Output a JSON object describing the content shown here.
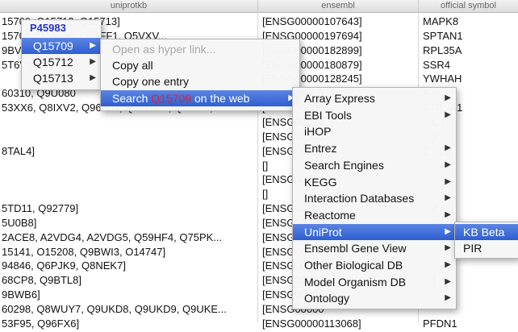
{
  "table": {
    "columns": [
      "uniprotkb",
      "ensembl",
      "official symbol"
    ],
    "rows": [
      [
        "15709, Q15712, Q15713]",
        "[ENSG00000107643]",
        "MAPK8"
      ],
      [
        "15709, Q16606, Q59FF1, Q5VXV...",
        "[ENSG00000197694]",
        "SPTAN1"
      ],
      [
        "9BVQ5",
        "[ENSG00000182899]",
        "RPL35A"
      ],
      [
        "5T6V9",
        "[ENSG00000180879]",
        "SSR4"
      ],
      [
        "",
        "[ENSG00000128245]",
        "YWHAH"
      ],
      [
        "60310, Q9U080",
        "[ENSG00000",
        "A"
      ],
      [
        "53XX6, Q8IXV2, Q96F84, Q96HW2, Q96IK6,...",
        "[ENSG00000",
        "ATP...A1"
      ],
      [
        "",
        "[ENSG00000",
        "...C7"
      ],
      [
        "",
        "[ENSG00000",
        "...3"
      ],
      [
        "8TAL4]",
        "[ENSG00000",
        "Z...16"
      ],
      [
        "",
        "[]",
        ""
      ],
      [
        "",
        "[ENSG00000",
        ""
      ],
      [
        "",
        "[]",
        ""
      ],
      [
        "5TD11, Q92779]",
        "[ENSG00000",
        "...4"
      ],
      [
        "5U0B8]",
        "[ENSG00000",
        "...K4"
      ],
      [
        "2ACE8, A2VDG4, A2VDG5, Q59HF4, Q75PK...",
        "[ENSG00000",
        ""
      ],
      [
        "15141, O15208, Q9BWI3, O14747]",
        "[ENSG00000",
        ""
      ],
      [
        "94846, Q6PJK9, Q8NEK7]",
        "[ENSG00000",
        ""
      ],
      [
        "68CP8, Q9BTL8]",
        "[ENSG00000",
        "...1"
      ],
      [
        "9BWB6]",
        "[ENSG00000",
        ""
      ],
      [
        "60298, Q8WUY7, Q9UKD8, Q9UKD9, Q9UKE...",
        "[ENSG00000",
        ""
      ],
      [
        "53F95, Q96FX6]",
        "[ENSG00000113068]",
        "PFDN1"
      ]
    ]
  },
  "menu1": {
    "title": "P45983",
    "items": [
      {
        "label": "Q15709",
        "highlighted": true
      },
      {
        "label": "Q15712",
        "highlighted": false
      },
      {
        "label": "Q15713",
        "highlighted": false
      }
    ]
  },
  "menu2": {
    "items": [
      {
        "label": "Open as hyper link...",
        "disabled": true
      },
      {
        "label": "Copy all",
        "disabled": false
      },
      {
        "label": "Copy one entry",
        "disabled": false
      }
    ],
    "search": {
      "prefix": "Search ",
      "id": "Q15709",
      "suffix": " on the web"
    }
  },
  "menu3": {
    "items": [
      "Array Express",
      "EBI Tools",
      "iHOP",
      "Entrez",
      "Search Engines",
      "KEGG",
      "Interaction Databases",
      "Reactome",
      "UniProt",
      "Ensembl Gene View",
      "Other Biological DB",
      "Model Organism DB",
      "Ontology"
    ],
    "highlighted_index": 8,
    "no_arrow_index": 2
  },
  "menu4": {
    "items": [
      "KB Beta",
      "PIR"
    ],
    "highlighted_index": 0
  },
  "colors": {
    "highlight": "#3a67d6",
    "id_red": "#e8202a",
    "title_blue": "#2233cc"
  }
}
